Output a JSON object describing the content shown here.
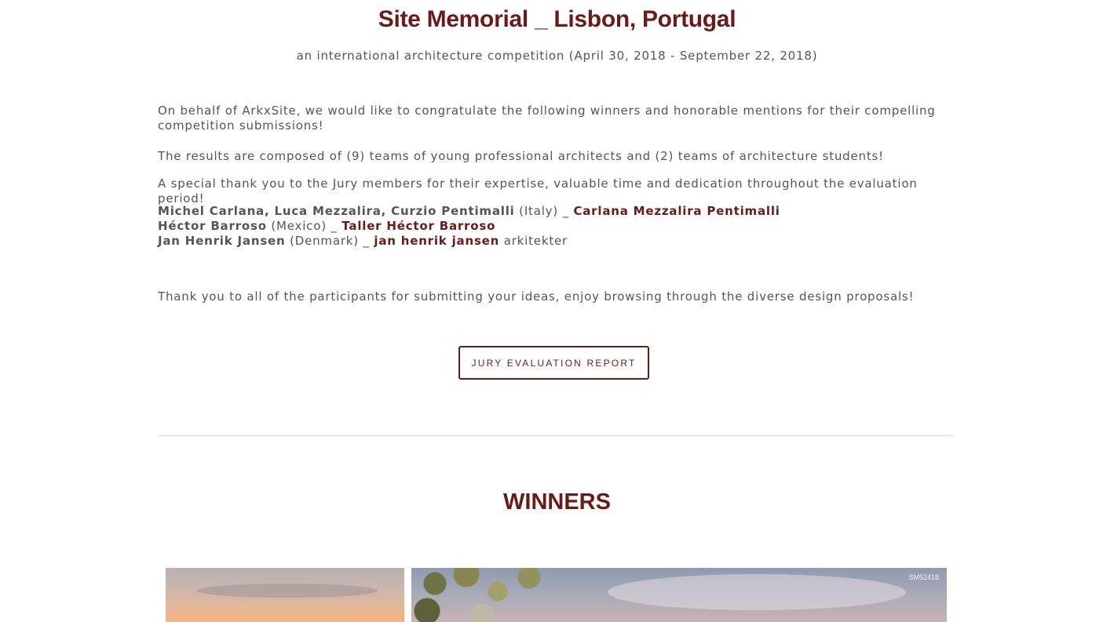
{
  "header": {
    "title": "Site Memorial _ Lisbon, Portugal",
    "subtitle": "an international architecture competition (April 30, 2018 - September 22, 2018)"
  },
  "intro": {
    "congrats": "On behalf of ArkxSite, we would like to congratulate the following winners and honorable mentions for their compelling competition submissions!",
    "composition": "The results are composed of (9) teams of young professional architects and (2) teams of architecture students!",
    "thanks_jury": "A special thank you to the Jury members for their expertise, valuable time and dedication throughout the evaluation period!",
    "thanks_participants": "Thank you to all of the participants for submitting your ideas, enjoy browsing through the diverse design proposals!"
  },
  "jury": [
    {
      "names": "Michel Carlana, Luca Mezzalira, Curzio Pentimalli",
      "country": " (Italy) _ ",
      "firm": "Carlana Mezzalira Pentimalli",
      "suffix": ""
    },
    {
      "names": "Héctor Barroso",
      "country": " (Mexico) _ ",
      "firm": "Taller Héctor Barroso",
      "suffix": ""
    },
    {
      "names": "Jan Henrik Jansen",
      "country": " (Denmark) _ ",
      "firm": "jan henrik jansen",
      "suffix": " arkitekter"
    }
  ],
  "report_button": {
    "label": "JURY EVALUATION REPORT"
  },
  "winners": {
    "heading": "WINNERS",
    "images": [
      {
        "code": ""
      },
      {
        "code": "SM52418"
      }
    ]
  },
  "colors": {
    "accent": "#6b1a17",
    "text": "#555555",
    "divider": "#d8d8d8"
  }
}
